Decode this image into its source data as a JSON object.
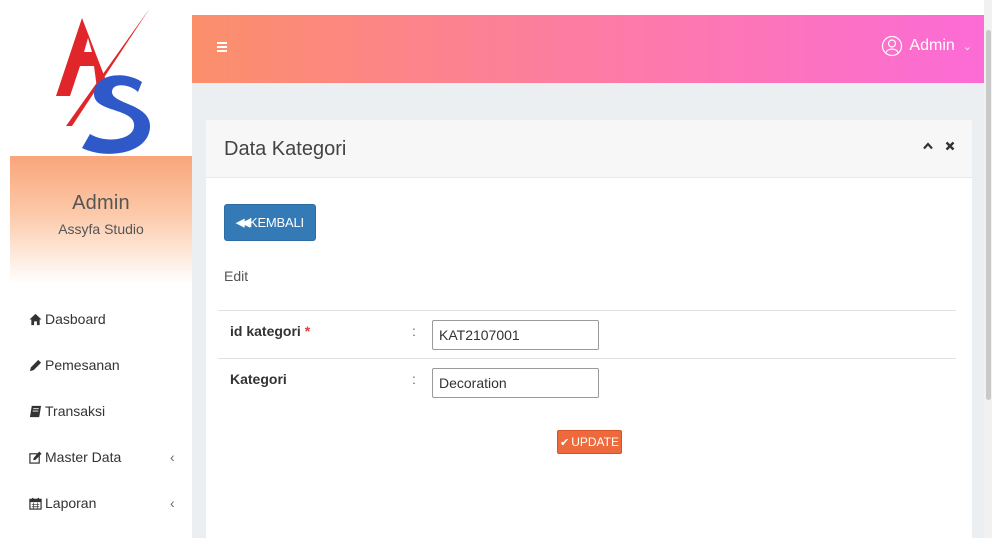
{
  "sidebar": {
    "profile": {
      "name": "Admin",
      "studio": "Assyfa Studio"
    },
    "items": [
      {
        "label": "Dasboard",
        "icon": "home-icon"
      },
      {
        "label": "Pemesanan",
        "icon": "pencil-icon"
      },
      {
        "label": "Transaksi",
        "icon": "book-icon"
      },
      {
        "label": "Master Data",
        "icon": "edit-icon",
        "chevron": "‹"
      },
      {
        "label": "Laporan",
        "icon": "calendar-icon",
        "chevron": "‹"
      }
    ]
  },
  "topbar": {
    "user_label": "Admin",
    "gradient": [
      "#fb8f6a",
      "#fd7aa9",
      "#fc6bd6"
    ]
  },
  "panel": {
    "title": "Data Kategori",
    "back_label": "KEMBALI",
    "edit_label": "Edit",
    "fields": [
      {
        "label": "id kategori",
        "required_mark": "*",
        "colon": ":",
        "value": "KAT2107001"
      },
      {
        "label": "Kategori",
        "colon": ":",
        "value": "Decoration"
      }
    ],
    "update_label": "UPDATE"
  },
  "colors": {
    "primary": "#337ab7",
    "update": "#ee6a3c",
    "logo_red": "#e0262b",
    "logo_blue": "#2f58c8"
  }
}
